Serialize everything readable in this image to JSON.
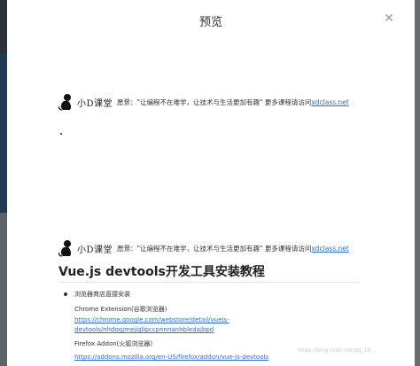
{
  "modal": {
    "title": "预览",
    "close_symbol": "✕"
  },
  "slogan": {
    "logo_text": "小D课堂",
    "text": "愿景：\"让编程不在难学，让技术与生活更加有趣\" 更多课程请访问",
    "link": "xdclass.net"
  },
  "doc": {
    "title": "Vue.js devtools开发工具安装教程",
    "bullet": "浏览器商店直接安装",
    "chrome_label": "Chrome Extension(谷歌浏览器)",
    "chrome_link_1": "https://chrome.google.com/webstore/detail/vuejs-",
    "chrome_link_2": "devtools/nhdogjmejiglipccpnnnanhbledajbpd",
    "firefox_label": "Firefox Addon(火狐浏览器)",
    "firefox_link": "https://addons.mozilla.org/en-US/firefox/addon/vue-js-devtools"
  },
  "watermark": "https://blog.csdn.net/qq_19..."
}
